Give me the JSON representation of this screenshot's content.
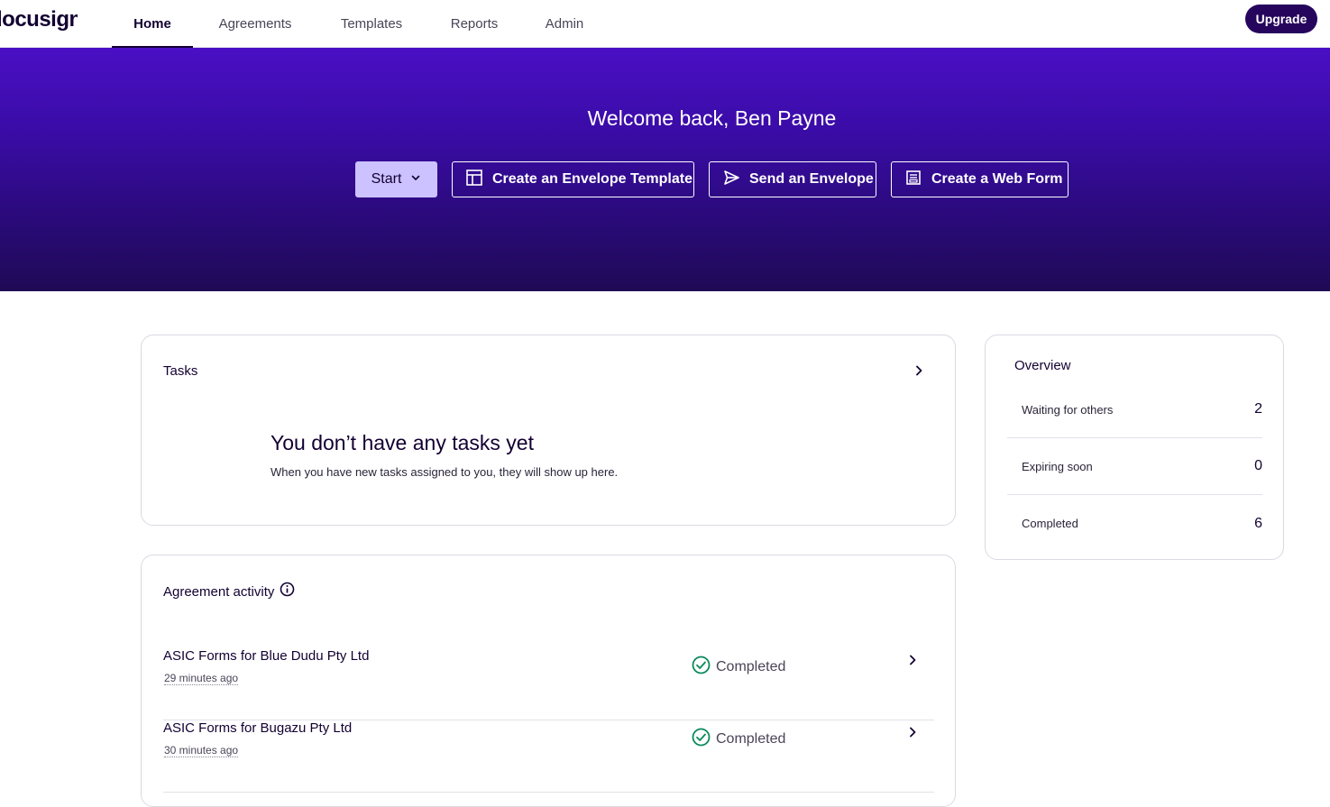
{
  "brand": {
    "logo_text": "docusign"
  },
  "nav": {
    "tabs": [
      {
        "label": "Home",
        "active": true
      },
      {
        "label": "Agreements",
        "active": false
      },
      {
        "label": "Templates",
        "active": false
      },
      {
        "label": "Reports",
        "active": false
      },
      {
        "label": "Admin",
        "active": false
      }
    ],
    "upgrade_label": "Upgrade"
  },
  "hero": {
    "welcome": "Welcome back, Ben Payne",
    "start_label": "Start",
    "actions": [
      {
        "label": "Create an Envelope Template",
        "icon": "template-icon"
      },
      {
        "label": "Send an Envelope",
        "icon": "send-icon"
      },
      {
        "label": "Create a Web Form",
        "icon": "web-form-icon"
      }
    ]
  },
  "tasks": {
    "title": "Tasks",
    "empty_title": "You don’t have any tasks yet",
    "empty_subtitle": "When you have new tasks assigned to you, they will show up here."
  },
  "activity": {
    "title": "Agreement activity",
    "rows": [
      {
        "title": "ASIC Forms for Blue Dudu Pty Ltd",
        "time": "29 minutes ago",
        "status": "Completed"
      },
      {
        "title": "ASIC Forms for Bugazu Pty Ltd",
        "time": "30 minutes ago",
        "status": "Completed"
      }
    ]
  },
  "overview": {
    "title": "Overview",
    "items": [
      {
        "label": "Waiting for others",
        "value": "2"
      },
      {
        "label": "Expiring soon",
        "value": "0"
      },
      {
        "label": "Completed",
        "value": "6"
      }
    ]
  },
  "colors": {
    "brand_dark": "#130032",
    "hero_top": "#4a0fc4",
    "hero_bottom": "#1f0a55",
    "start_button": "#cbc2ff",
    "upgrade_button": "#26065d",
    "status_success": "#0a8a5c"
  }
}
